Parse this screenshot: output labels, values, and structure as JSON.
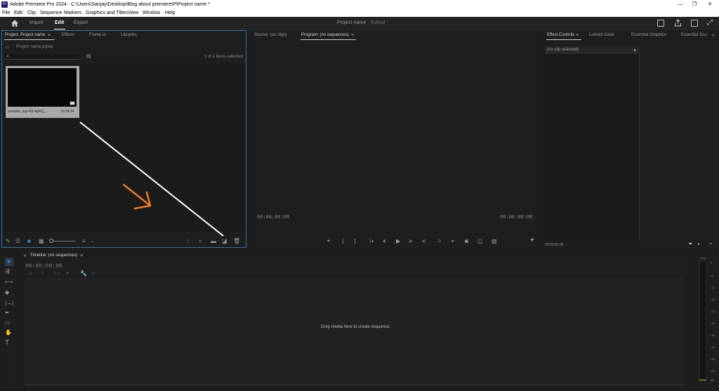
{
  "titlebar": {
    "title": "Adobe Premiere Pro 2024 - C:\\Users\\Sanjay\\Desktop\\Blog about premiere\\P\\Project name *",
    "app_icon": "Pr"
  },
  "menu": [
    "File",
    "Edit",
    "Clip",
    "Sequence",
    "Markers",
    "Graphics and Titles",
    "View",
    "Window",
    "Help"
  ],
  "appbar": {
    "tabs": [
      "Import",
      "Edit",
      "Export"
    ],
    "active_tab": "Edit",
    "project_name": "Project name",
    "status": "- Edited"
  },
  "project_panel": {
    "tabs": [
      "Project: Project name",
      "Effects",
      "Frame.io",
      "Libraries"
    ],
    "file": "Project name.prproj",
    "items_selected": "1 of 1 items selected",
    "clip": {
      "name": "youtube_aqz-KE-bpKQ_...",
      "duration": "10:34:34"
    }
  },
  "source_panel": {
    "tabs": [
      "Source: (no clips)",
      "Program: (no sequences)"
    ],
    "tc_left": "00:00:00:00",
    "tc_right": "00:00:00:00"
  },
  "effect_panel": {
    "tabs": [
      "Effect Controls",
      "Lumetri Color",
      "Essential Graphics",
      "Essential Sou"
    ],
    "no_clip": "(no clip selected)",
    "tc": "00:00:00:00"
  },
  "timeline": {
    "title": "Timeline: (no sequences)",
    "tc": "00:00:00:00",
    "drop_text": "Drop media here to create sequence."
  },
  "meter": {
    "labels": [
      "0",
      "-6",
      "-12",
      "-18",
      "-24",
      "-30",
      "-36",
      "-42",
      "-48",
      "-54"
    ],
    "unit": "dB"
  },
  "colors": {
    "accent": "#2d8ceb",
    "arrow": "#f07a22",
    "panel": "#1e1e1e",
    "bg": "#1d1d1d"
  }
}
